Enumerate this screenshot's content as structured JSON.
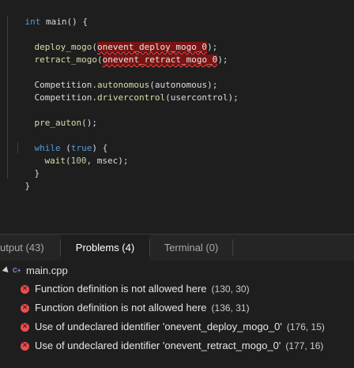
{
  "editor": {
    "line1": {
      "kw": "int",
      "rest": " main() {"
    },
    "line2": {
      "fn": "deploy_mogo",
      "open": "(",
      "arg": "onevent_deploy_mogo_0",
      "close": ");"
    },
    "line3": {
      "fn": "retract_mogo",
      "open": "(",
      "arg": "onevent_retract_mogo_0",
      "close": ");"
    },
    "line4": {
      "obj": "Competition.",
      "fn": "autonomous",
      "args": "(autonomous);"
    },
    "line5": {
      "obj": "Competition.",
      "fn": "drivercontrol",
      "args": "(usercontrol);"
    },
    "line6": {
      "fn": "pre_auton",
      "args": "();"
    },
    "line7": {
      "kw": "while",
      "open": " (",
      "kw2": "true",
      "close": ") {"
    },
    "line8": {
      "fn": "wait",
      "open": "(",
      "num": "100",
      "rest": ", msec);"
    },
    "line9": {
      "text": "}"
    },
    "line10": {
      "text": "}"
    }
  },
  "panel": {
    "tabs": [
      {
        "label": "utput (43)"
      },
      {
        "label": "Problems (4)"
      },
      {
        "label": "Terminal (0)"
      }
    ],
    "file": "main.cpp",
    "file_icon": "C",
    "problems": [
      {
        "message": "Function definition is not allowed here",
        "location": "(130, 30)"
      },
      {
        "message": "Function definition is not allowed here",
        "location": "(136, 31)"
      },
      {
        "message": "Use of undeclared identifier 'onevent_deploy_mogo_0'",
        "location": "(176, 15)"
      },
      {
        "message": "Use of undeclared identifier 'onevent_retract_mogo_0'",
        "location": "(177, 16)"
      }
    ]
  },
  "colors": {
    "background": "#1e1e1e",
    "keyword": "#569cd6",
    "function": "#dcdcaa",
    "error": "#f14c4c"
  }
}
